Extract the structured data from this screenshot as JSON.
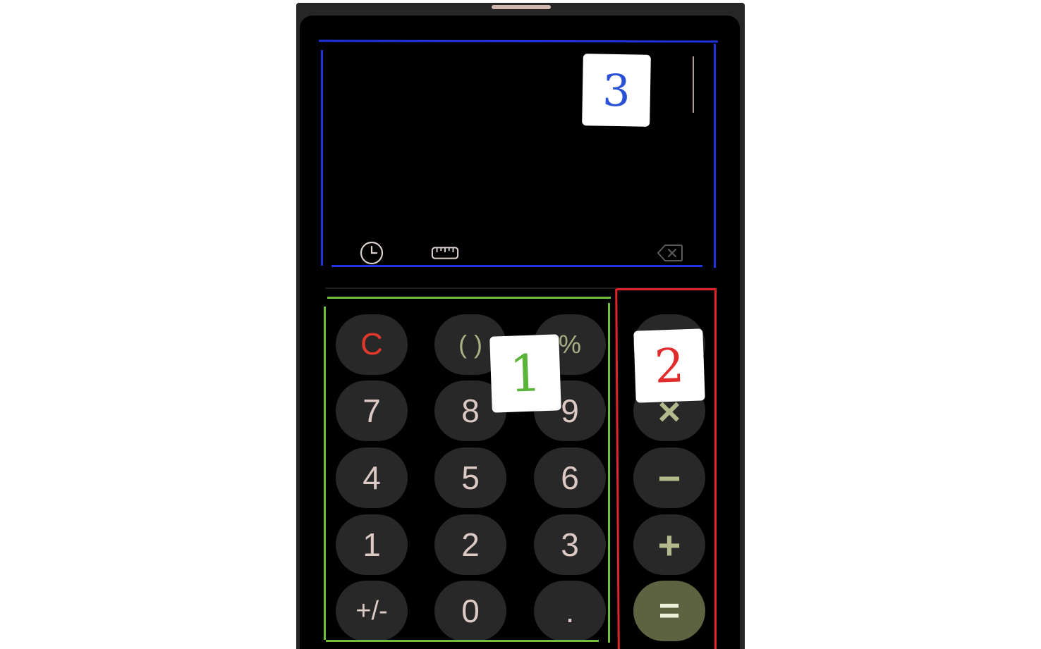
{
  "display": {
    "expression": ""
  },
  "toolbar": {
    "history_icon": "clock-icon",
    "converter_icon": "ruler-icon",
    "backspace_icon": "backspace-icon"
  },
  "keypad": {
    "rows": [
      [
        "C",
        "( )",
        "%"
      ],
      [
        "7",
        "8",
        "9"
      ],
      [
        "4",
        "5",
        "6"
      ],
      [
        "1",
        "2",
        "3"
      ],
      [
        "+/-",
        "0",
        "."
      ]
    ]
  },
  "operators": [
    "÷",
    "×",
    "−",
    "+",
    "="
  ],
  "annotations": {
    "label_1": "1",
    "label_2": "2",
    "label_3": "3",
    "colors": {
      "keypad_box": "#6fbf3a",
      "operators_box": "#e0242a",
      "display_box": "#1f33e0"
    }
  },
  "colors": {
    "clear_key": "#e2382b",
    "accent": "#a7b084",
    "equals_bg": "#5d6341",
    "key_bg": "#282828",
    "digit_text": "#dcc9c4"
  }
}
